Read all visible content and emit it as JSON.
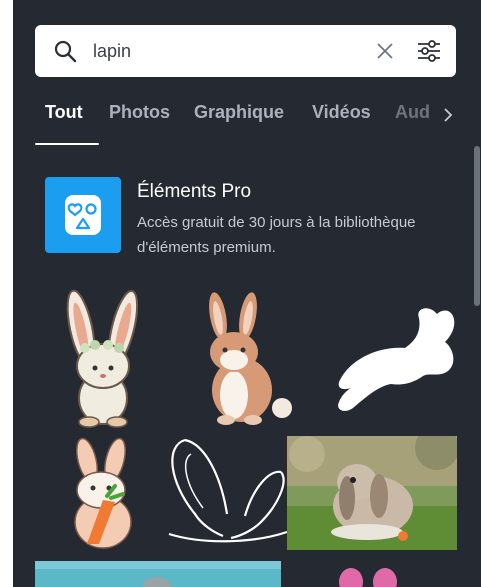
{
  "search": {
    "value": "lapin",
    "placeholder": ""
  },
  "tabs": [
    {
      "label": "Tout",
      "active": true
    },
    {
      "label": "Photos",
      "active": false
    },
    {
      "label": "Graphique",
      "active": false
    },
    {
      "label": "Vidéos",
      "active": false
    },
    {
      "label": "Aud",
      "active": false
    }
  ],
  "promo": {
    "title": "Éléments Pro",
    "description": "Accès gratuit de 30 jours à la bibliothèque d'éléments premium."
  },
  "icons": {
    "search": "search-icon",
    "clear": "close-icon",
    "filters": "sliders-icon",
    "tabs_next": "chevron-right-icon"
  },
  "colors": {
    "panel_bg": "#252a32",
    "tab_active": "#ffffff",
    "tab_inactive": "#aab1bd",
    "pro_accent": "#1b9df0"
  },
  "results": [
    "bunny-flower-crown-graphic",
    "brown-bunny-sitting-graphic",
    "white-jumping-rabbit-silhouette",
    "bunny-holding-carrot-graphic",
    "bunny-ears-outline-graphic",
    "lop-rabbit-on-grass-photo",
    "teal-background-photo",
    "pink-bunny-ears-graphic"
  ]
}
